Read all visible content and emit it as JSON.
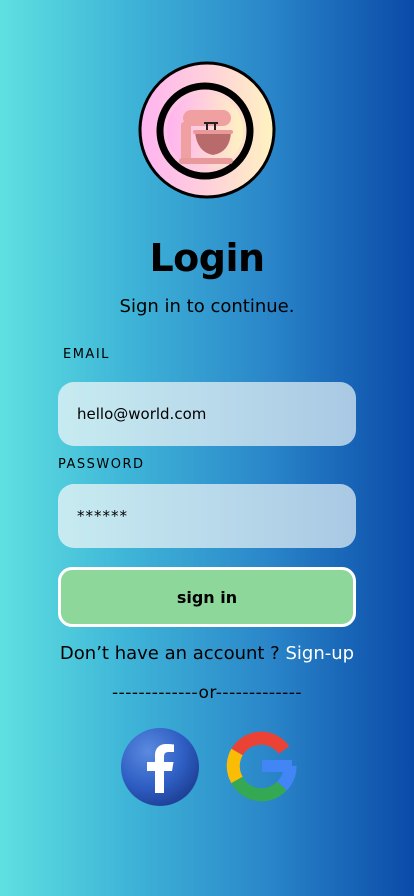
{
  "header": {
    "title": "Login",
    "subtitle": "Sign in to continue."
  },
  "form": {
    "email_label": "EMAIL",
    "email_value": "hello@world.com",
    "password_label": "PASSWORD",
    "password_value": "******",
    "submit_label": "sign in"
  },
  "signup": {
    "prompt": "Don’t have an account ? ",
    "link_label": "Sign-up"
  },
  "divider": {
    "text": "-------------or-------------"
  },
  "social": {
    "facebook_icon": "facebook-logo",
    "google_icon": "google-logo"
  },
  "colors": {
    "background_left": "#5fe0e0",
    "background_right": "#0a4aa8",
    "button": "#8dd79a",
    "link": "#ffffff"
  }
}
